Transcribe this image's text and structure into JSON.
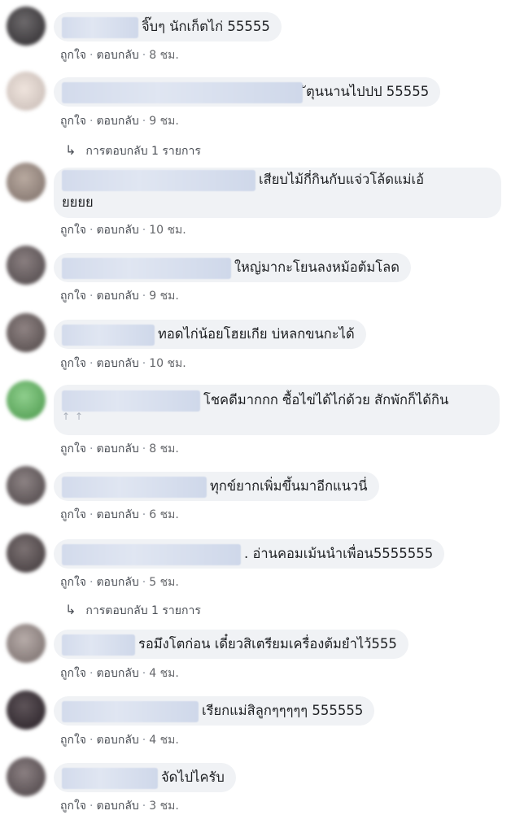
{
  "actions": {
    "like": "ถูกใจ",
    "reply": "ตอบกลับ",
    "sep": "·"
  },
  "comments": [
    {
      "text": "จิ๊บๆ นักเก็ตไก่ 55555",
      "time": "8 ชม."
    },
    {
      "text": "ัตุนนานไปปป 55555",
      "time": "9 ชม.",
      "replies": "การตอบกลับ 1 รายการ"
    },
    {
      "text": "เสียบไม้กี่กินกับแจ่วโล้ดแม่เอ้ยยยย",
      "line1": "เสียบไม้กี่กินกับแจ่วโล้ดแม่เอ้",
      "line2": "ยยยย",
      "time": "10 ชม."
    },
    {
      "text": "ใหญ่มากะโยนลงหม้อต้มโลด",
      "time": "9 ชม."
    },
    {
      "text": "ทอดไก่น้อยโฮยเกีย บ่หลกขนกะได้",
      "time": "10 ชม."
    },
    {
      "text": "โชคดีมากกก ซื้อไข่ได้ไก่ด้วย สักพักก็ได้กิน",
      "extra": "↑↑",
      "time": "8 ชม."
    },
    {
      "text": "ทุกข์ยากเพิ่มขึ้นมาอีกแนวนี่",
      "time": "6 ชม."
    },
    {
      "text": ". อ่านคอมเม้นนำเพื่อน5555555",
      "time": "5 ชม.",
      "replies": "การตอบกลับ 1 รายการ"
    },
    {
      "text": "รอมึงโตก่อน เดี๋ยวสิเตรียมเครื่องต้มยำไว้555",
      "time": "4 ชม."
    },
    {
      "text": "เรียกแม่สิลูกๆๆๆๆๆ 555555",
      "time": "4 ชม."
    },
    {
      "text": "จัดไปไครับ",
      "time": "3 ชม."
    }
  ],
  "colors": {
    "bubble": "#f0f2f5",
    "meta": "#65676b",
    "link": "#4b4f56"
  }
}
